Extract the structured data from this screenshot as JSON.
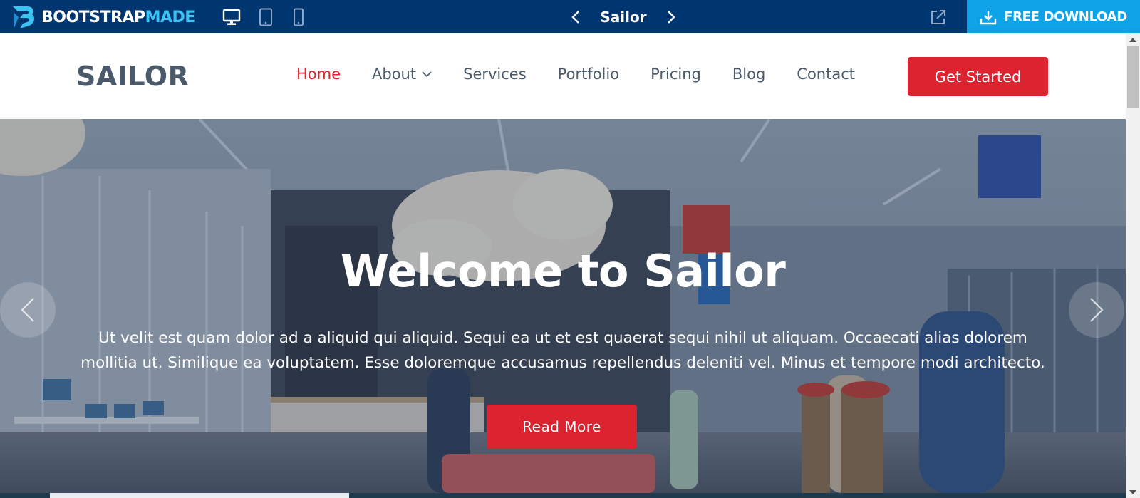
{
  "topbar": {
    "brand_part1": "BOOTSTRAP",
    "brand_part2": "MADE",
    "theme_name": "Sailor",
    "download_label": "FREE DOWNLOAD",
    "devices": [
      "desktop-icon",
      "tablet-icon",
      "phone-icon"
    ],
    "colors": {
      "bar": "#00366f",
      "download": "#0ea2e6",
      "brand_accent": "#3ec1f3"
    }
  },
  "header": {
    "logo": "SAILOR",
    "nav": [
      {
        "label": "Home",
        "active": true
      },
      {
        "label": "About",
        "dropdown": true
      },
      {
        "label": "Services"
      },
      {
        "label": "Portfolio"
      },
      {
        "label": "Pricing"
      },
      {
        "label": "Blog"
      },
      {
        "label": "Contact"
      }
    ],
    "cta": "Get Started",
    "colors": {
      "text": "#4b5a6b",
      "active": "#d9232d",
      "cta": "#dc2430"
    }
  },
  "hero": {
    "title": "Welcome to Sailor",
    "text": "Ut velit est quam dolor ad a aliquid qui aliquid. Sequi ea ut et est quaerat sequi nihil ut aliquam. Occaecati alias dolorem mollitia ut. Similique ea voluptatem. Esse doloremque accusamus repellendus deleniti vel. Minus et tempore modi architecto.",
    "button": "Read More"
  }
}
